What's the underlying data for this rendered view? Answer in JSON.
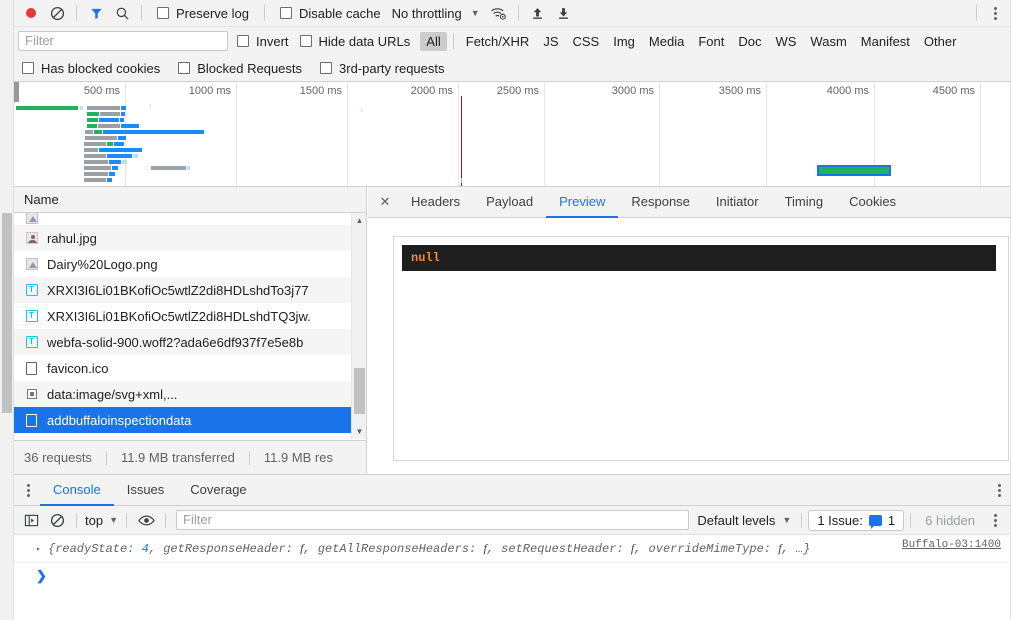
{
  "network_toolbar": {
    "record_icon": "record-circle-icon",
    "clear_icon": "clear-prohibited-icon",
    "filter_icon": "funnel-filter-icon",
    "search_icon": "search-icon",
    "preserve_log": "Preserve log",
    "disable_cache": "Disable cache",
    "throttling": "No throttling",
    "throttling_caret": "▼",
    "wifi_icon": "network-conditions-icon",
    "import_icon": "import-har-upload-icon",
    "export_icon": "export-har-download-icon",
    "more_icon": "more-options-kebab-icon",
    "accent_blue": "#1a73e8",
    "record_red": "#e53935"
  },
  "filter_bar": {
    "filter_placeholder": "Filter",
    "filter_value": "",
    "invert": "Invert",
    "hide_data_urls": "Hide data URLs",
    "types": [
      "All",
      "Fetch/XHR",
      "JS",
      "CSS",
      "Img",
      "Media",
      "Font",
      "Doc",
      "WS",
      "Wasm",
      "Manifest",
      "Other"
    ],
    "active_type": "All"
  },
  "blocked_bar": {
    "has_blocked_cookies": "Has blocked cookies",
    "blocked_requests": "Blocked Requests",
    "third_party_requests": "3rd-party requests"
  },
  "overview": {
    "ticks": [
      "500 ms",
      "1000 ms",
      "1500 ms",
      "2000 ms",
      "2500 ms",
      "3000 ms",
      "3500 ms",
      "4000 ms",
      "4500 ms"
    ],
    "dom_content_loaded_marker_color": "#8b1a2b",
    "selected_request_bar_color": "#21b35a",
    "selection_outline_color": "#1a73e8"
  },
  "request_list": {
    "column_header": "Name",
    "rows": [
      {
        "name": "",
        "icon": "image-file-icon",
        "clipped": true,
        "selected": false
      },
      {
        "name": "rahul.jpg",
        "icon": "person-image-icon",
        "clipped": false,
        "selected": false
      },
      {
        "name": "Dairy%20Logo.png",
        "icon": "image-file-icon",
        "clipped": false,
        "selected": false
      },
      {
        "name": "XRXI3I6Li01BKofiOc5wtlZ2di8HDLshdTo3j77",
        "icon": "font-file-icon",
        "clipped": false,
        "selected": false
      },
      {
        "name": "XRXI3I6Li01BKofiOc5wtlZ2di8HDLshdTQ3jw.",
        "icon": "font-file-icon",
        "clipped": false,
        "selected": false
      },
      {
        "name": "webfa-solid-900.woff2?ada6e6df937f7e5e8b",
        "icon": "font-file-icon",
        "clipped": false,
        "selected": false
      },
      {
        "name": "favicon.ico",
        "icon": "document-file-icon",
        "clipped": false,
        "selected": false
      },
      {
        "name": "data:image/svg+xml,...",
        "icon": "data-url-icon",
        "clipped": false,
        "selected": false
      },
      {
        "name": "addbuffaloinspectiondata",
        "icon": "document-file-icon",
        "clipped": false,
        "selected": true
      }
    ],
    "scroll_up_arrow": "▲",
    "scroll_down_arrow": "▼"
  },
  "status_bar": {
    "requests": "36 requests",
    "transferred": "11.9 MB transferred",
    "resources": "11.9 MB res"
  },
  "detail_pane": {
    "close_label": "✕",
    "tabs": [
      "Headers",
      "Payload",
      "Preview",
      "Response",
      "Initiator",
      "Timing",
      "Cookies"
    ],
    "active_tab": "Preview",
    "preview_value": "null",
    "preview_value_color": "#f28b3c",
    "preview_bg": "#1e1e1e"
  },
  "drawer": {
    "menu_icon": "more-tabs-kebab-icon",
    "tabs": [
      "Console",
      "Issues",
      "Coverage"
    ],
    "active_tab": "Console",
    "sidebar_icon": "console-sidebar-icon",
    "clear_icon": "clear-console-prohibited-icon",
    "context": "top",
    "context_caret": "▼",
    "eye_icon": "live-expression-eye-icon",
    "filter_placeholder": "Filter",
    "filter_value": "",
    "levels": "Default levels",
    "levels_caret": "▼",
    "issue_label": "1 Issue:",
    "issue_count": "1",
    "hidden_count": "6 hidden",
    "settings_icon": "console-settings-kebab-icon"
  },
  "console_output": {
    "disclosure": "▸",
    "source_link": "Buffalo-03:1400",
    "log_parts": [
      {
        "t": "{readyState: ",
        "k": "obj"
      },
      {
        "t": "4",
        "k": "num"
      },
      {
        "t": ", getResponseHeader: ",
        "k": "obj"
      },
      {
        "t": "f",
        "k": "fn"
      },
      {
        "t": ", getAllResponseHeaders: ",
        "k": "obj"
      },
      {
        "t": "f",
        "k": "fn"
      },
      {
        "t": ", setRequestHeader: ",
        "k": "obj"
      },
      {
        "t": "f",
        "k": "fn"
      },
      {
        "t": ", overrideMimeType: ",
        "k": "obj"
      },
      {
        "t": "f",
        "k": "fn"
      },
      {
        "t": ", …}",
        "k": "obj"
      }
    ],
    "prompt": "❯"
  }
}
